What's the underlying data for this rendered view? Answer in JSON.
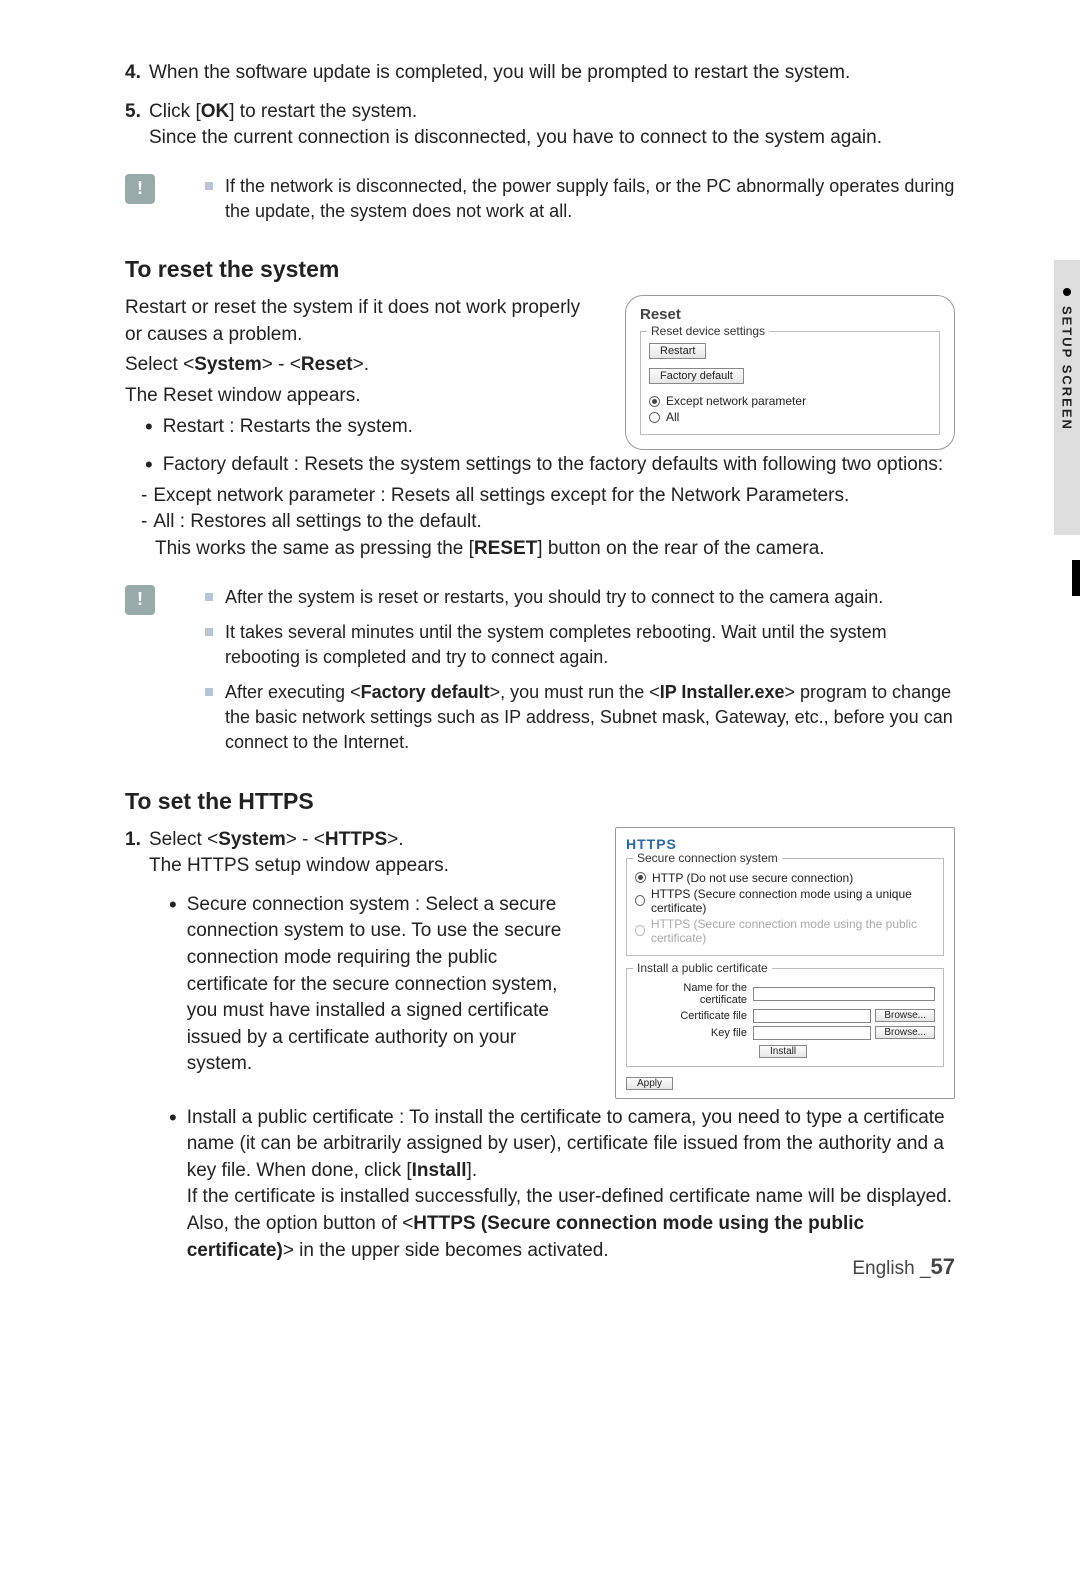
{
  "steps": {
    "s4": {
      "num": "4.",
      "text": "When the software update is completed, you will be prompted to restart the system."
    },
    "s5": {
      "num": "5.",
      "text1_pre": "Click [",
      "text1_bold": "OK",
      "text1_post": "] to restart the system.",
      "text2": "Since the current connection is disconnected, you have to connect to the system again."
    }
  },
  "note1": {
    "n1": "If the network is disconnected, the power supply fails, or the PC abnormally operates during the update, the system does not work at all."
  },
  "reset": {
    "heading": "To reset the system",
    "p1": "Restart or reset the system if it does not work properly or causes a problem.",
    "sel_pre": "Select <",
    "sel_b1": "System",
    "sel_mid": "> - <",
    "sel_b2": "Reset",
    "sel_post": ">.",
    "p2": "The Reset window appears.",
    "b1": "Restart : Restarts the system.",
    "b2": "Factory default : Resets the system settings to the factory defaults with following two options:",
    "d1": "Except network parameter : Resets all settings except for the Network Parameters.",
    "d2": "All : Restores all settings to the default.",
    "d2s_pre": "This works the same as pressing the [",
    "d2s_b": "RESET",
    "d2s_post": "] button on the rear of the camera."
  },
  "resetPanel": {
    "title": "Reset",
    "legend": "Reset device settings",
    "restart": "Restart",
    "factory": "Factory default",
    "opt1": "Except network parameter",
    "opt2": "All"
  },
  "note2": {
    "n1": "After the system is reset or restarts, you should try to connect to the camera again.",
    "n2": "It takes several minutes until the system completes rebooting. Wait until the system rebooting is completed and try to connect again.",
    "n3_pre": "After executing <",
    "n3_b1": "Factory default",
    "n3_mid": ">, you must run the <",
    "n3_b2": "IP Installer.exe",
    "n3_post": "> program to change the basic network settings such as IP address, Subnet mask, Gateway, etc., before you can connect to the Internet."
  },
  "https": {
    "heading": "To set the HTTPS",
    "s1num": "1.",
    "s1_pre": "Select <",
    "s1_b1": "System",
    "s1_mid": "> - <",
    "s1_b2": "HTTPS",
    "s1_post": ">.",
    "s1_line2": "The HTTPS setup window appears.",
    "b1": "Secure connection system : Select a secure connection system to use. To use the secure connection mode requiring the public certificate for the secure connection system, you must have installed a signed certificate issued by a certificate authority on your system.",
    "b2_pre": "Install a public certificate : To install the certificate to camera, you need to type a certificate name (it can be arbitrarily assigned by user), certificate file issued from the authority and a key file. When done, click [",
    "b2_b1": "Install",
    "b2_mid1": "].",
    "b2_line2_pre": "If the certificate is installed successfully, the user-defined certificate name will be displayed. Also, the option button of <",
    "b2_b2": "HTTPS (Secure connection mode using the public certificate)",
    "b2_post": "> in the upper side becomes activated."
  },
  "httpsPanel": {
    "title": "HTTPS",
    "legend1": "Secure connection system",
    "r1": "HTTP  (Do not use secure connection)",
    "r2": "HTTPS (Secure connection mode using a unique certificate)",
    "r3": "HTTPS (Secure connection mode using the public certificate)",
    "legend2": "Install a public certificate",
    "f1": "Name for the certificate",
    "f2": "Certificate file",
    "f3": "Key file",
    "browse": "Browse...",
    "install": "Install",
    "apply": "Apply"
  },
  "sideTab": "SETUP SCREEN",
  "footer": {
    "lang": "English _",
    "page": "57"
  }
}
